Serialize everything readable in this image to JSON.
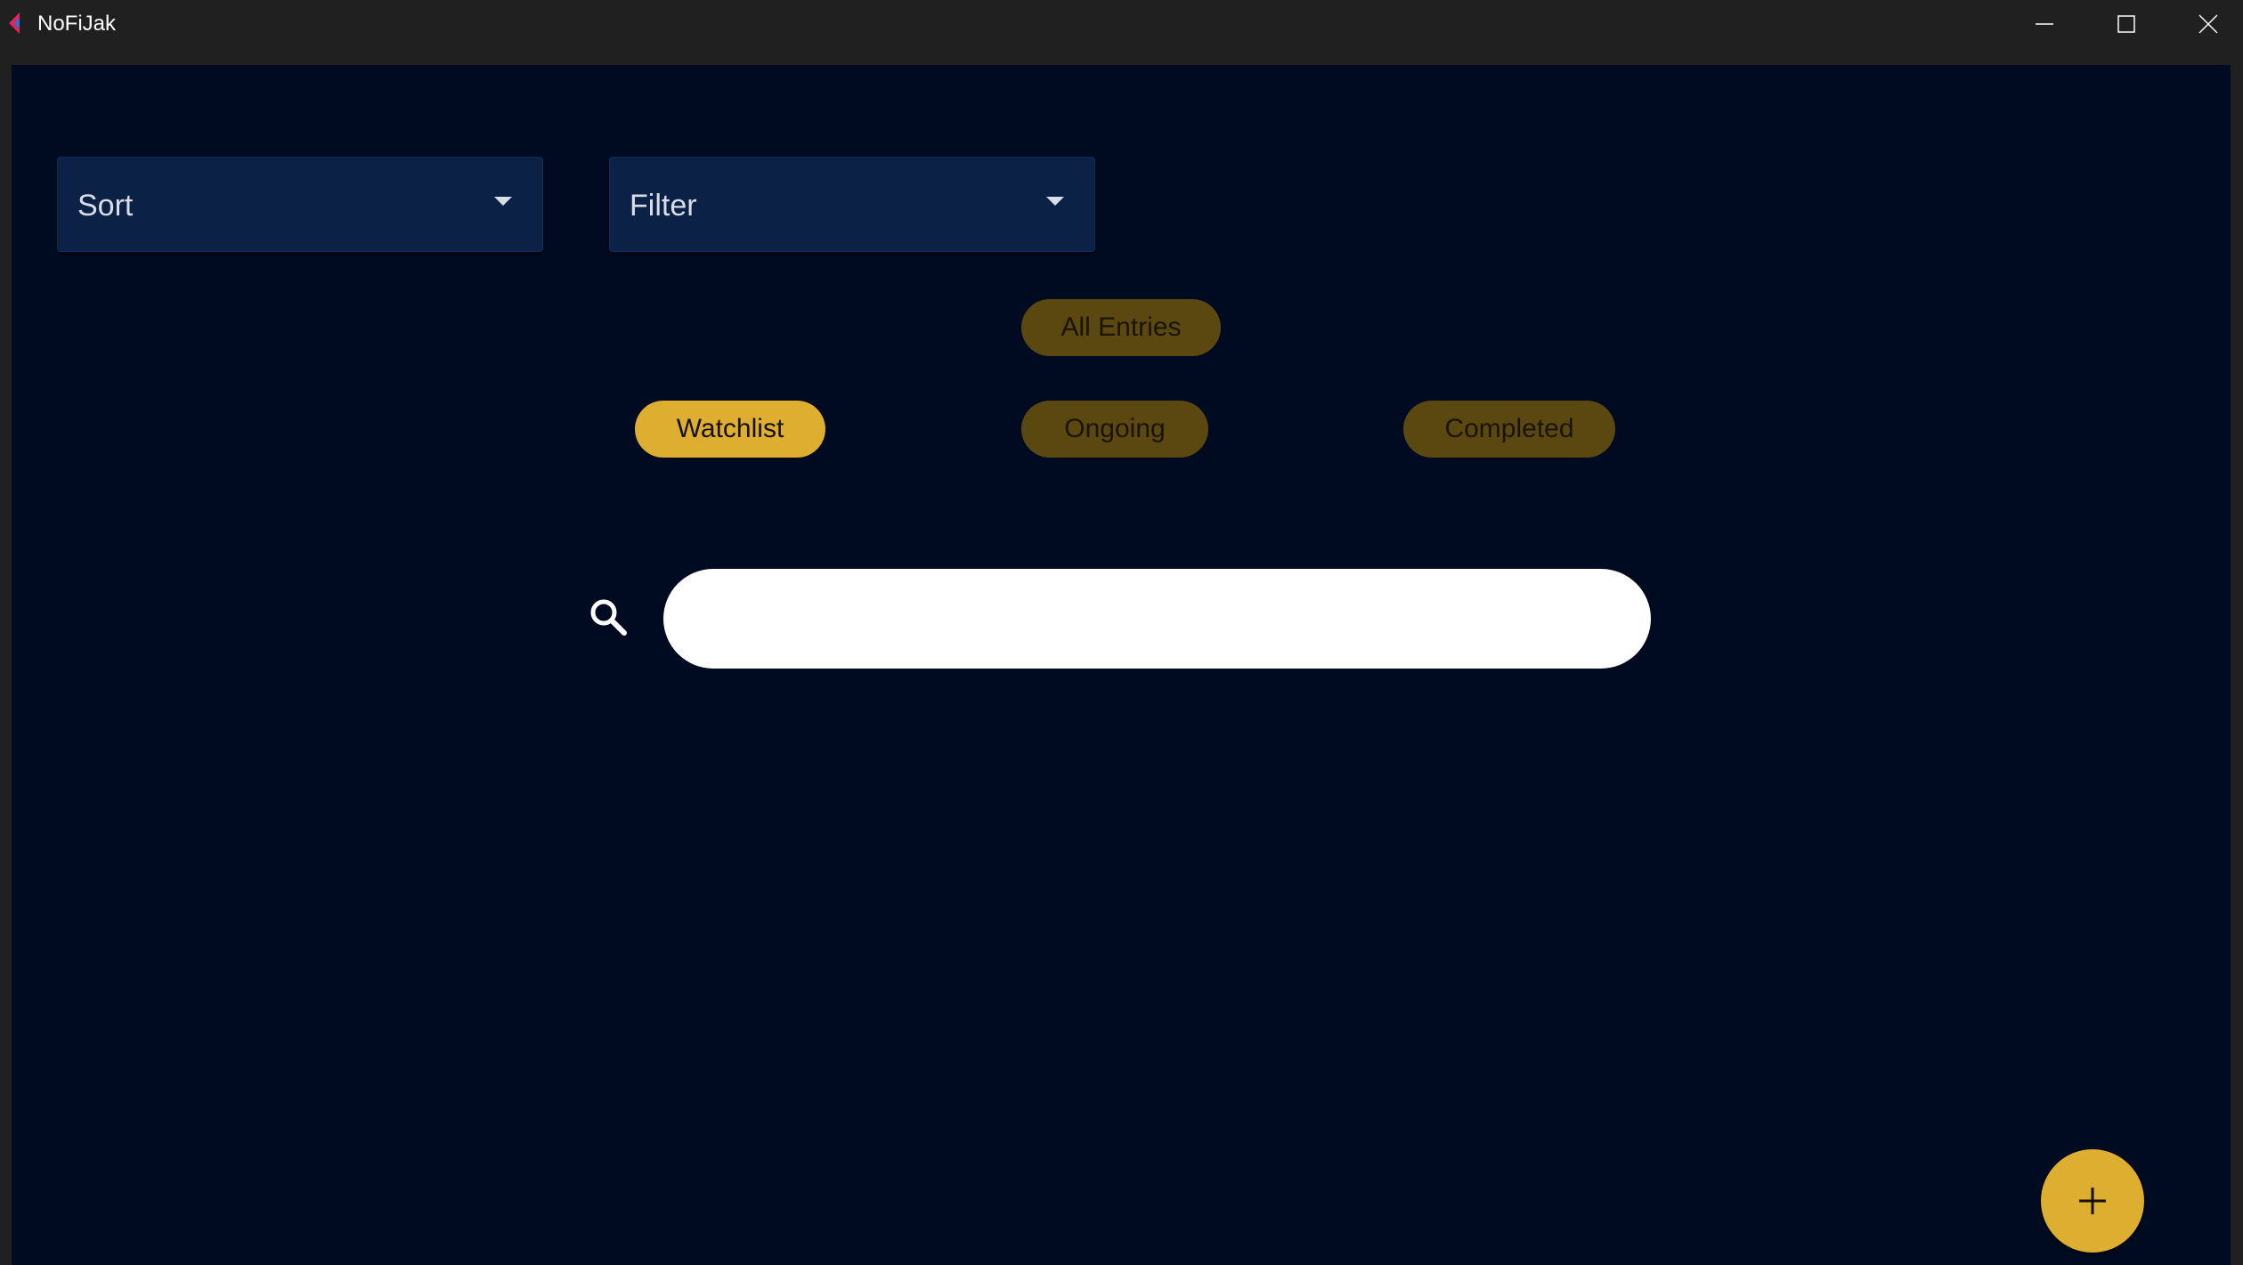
{
  "window": {
    "title": "NoFiJak",
    "icon": "app-logo-icon",
    "controls": [
      "minimize-icon",
      "maximize-icon",
      "close-icon"
    ]
  },
  "controls": {
    "sort_label": "Sort",
    "filter_label": "Filter"
  },
  "chips": {
    "all_entries": "All Entries",
    "watchlist": "Watchlist",
    "ongoing": "Ongoing",
    "completed": "Completed",
    "selected": "Watchlist"
  },
  "search": {
    "value": "",
    "placeholder": "",
    "icon": "search-icon"
  },
  "fab": {
    "icon": "plus-icon"
  },
  "colors": {
    "background": "#000b21",
    "titlebar": "#202020",
    "dropdown": "#0b2146",
    "accent": "#ddae2f",
    "chip_inactive": "#5a4810",
    "search_field": "#ffffff"
  }
}
